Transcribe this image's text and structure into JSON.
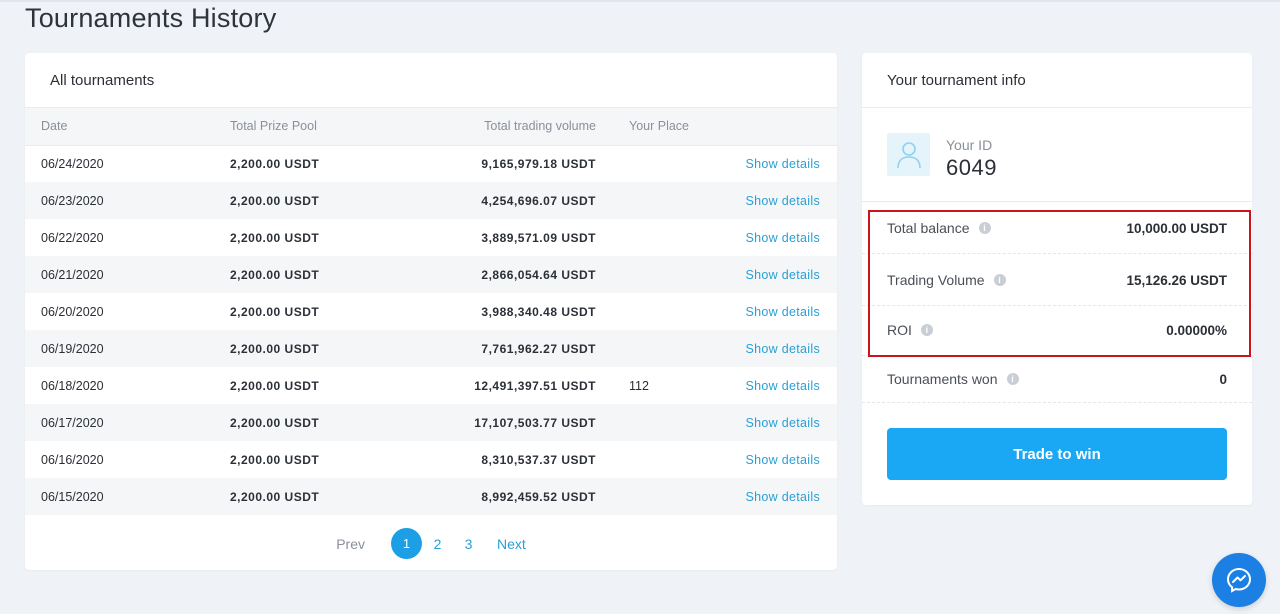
{
  "page": {
    "title": "Tournaments History"
  },
  "tournaments": {
    "header": "All tournaments",
    "columns": {
      "date": "Date",
      "prize": "Total Prize Pool",
      "volume": "Total trading volume",
      "place": "Your Place"
    },
    "rows": [
      {
        "date": "06/24/2020",
        "prize": "2,200.00 USDT",
        "volume": "9,165,979.18 USDT",
        "place": "",
        "action": "Show details"
      },
      {
        "date": "06/23/2020",
        "prize": "2,200.00 USDT",
        "volume": "4,254,696.07 USDT",
        "place": "",
        "action": "Show details"
      },
      {
        "date": "06/22/2020",
        "prize": "2,200.00 USDT",
        "volume": "3,889,571.09 USDT",
        "place": "",
        "action": "Show details"
      },
      {
        "date": "06/21/2020",
        "prize": "2,200.00 USDT",
        "volume": "2,866,054.64 USDT",
        "place": "",
        "action": "Show details"
      },
      {
        "date": "06/20/2020",
        "prize": "2,200.00 USDT",
        "volume": "3,988,340.48 USDT",
        "place": "",
        "action": "Show details"
      },
      {
        "date": "06/19/2020",
        "prize": "2,200.00 USDT",
        "volume": "7,761,962.27 USDT",
        "place": "",
        "action": "Show details"
      },
      {
        "date": "06/18/2020",
        "prize": "2,200.00 USDT",
        "volume": "12,491,397.51 USDT",
        "place": "112",
        "action": "Show details"
      },
      {
        "date": "06/17/2020",
        "prize": "2,200.00 USDT",
        "volume": "17,107,503.77 USDT",
        "place": "",
        "action": "Show details"
      },
      {
        "date": "06/16/2020",
        "prize": "2,200.00 USDT",
        "volume": "8,310,537.37 USDT",
        "place": "",
        "action": "Show details"
      },
      {
        "date": "06/15/2020",
        "prize": "2,200.00 USDT",
        "volume": "8,992,459.52 USDT",
        "place": "",
        "action": "Show details"
      }
    ],
    "pagination": {
      "prev": "Prev",
      "pages": [
        "1",
        "2",
        "3"
      ],
      "current": "1",
      "next": "Next"
    }
  },
  "info": {
    "header": "Your tournament info",
    "id_label": "Your ID",
    "id_value": "6049",
    "stats": [
      {
        "label": "Total balance",
        "value": "10,000.00 USDT"
      },
      {
        "label": "Trading Volume",
        "value": "15,126.26 USDT"
      },
      {
        "label": "ROI",
        "value": "0.00000%"
      },
      {
        "label": "Tournaments won",
        "value": "0"
      }
    ],
    "button": "Trade to win"
  },
  "icons": {
    "avatar": "user-icon",
    "info": "info-icon",
    "chat": "messenger-icon"
  },
  "colors": {
    "accent": "#1aa8f5",
    "link": "#2a9fd6",
    "highlight": "#c8141c"
  }
}
